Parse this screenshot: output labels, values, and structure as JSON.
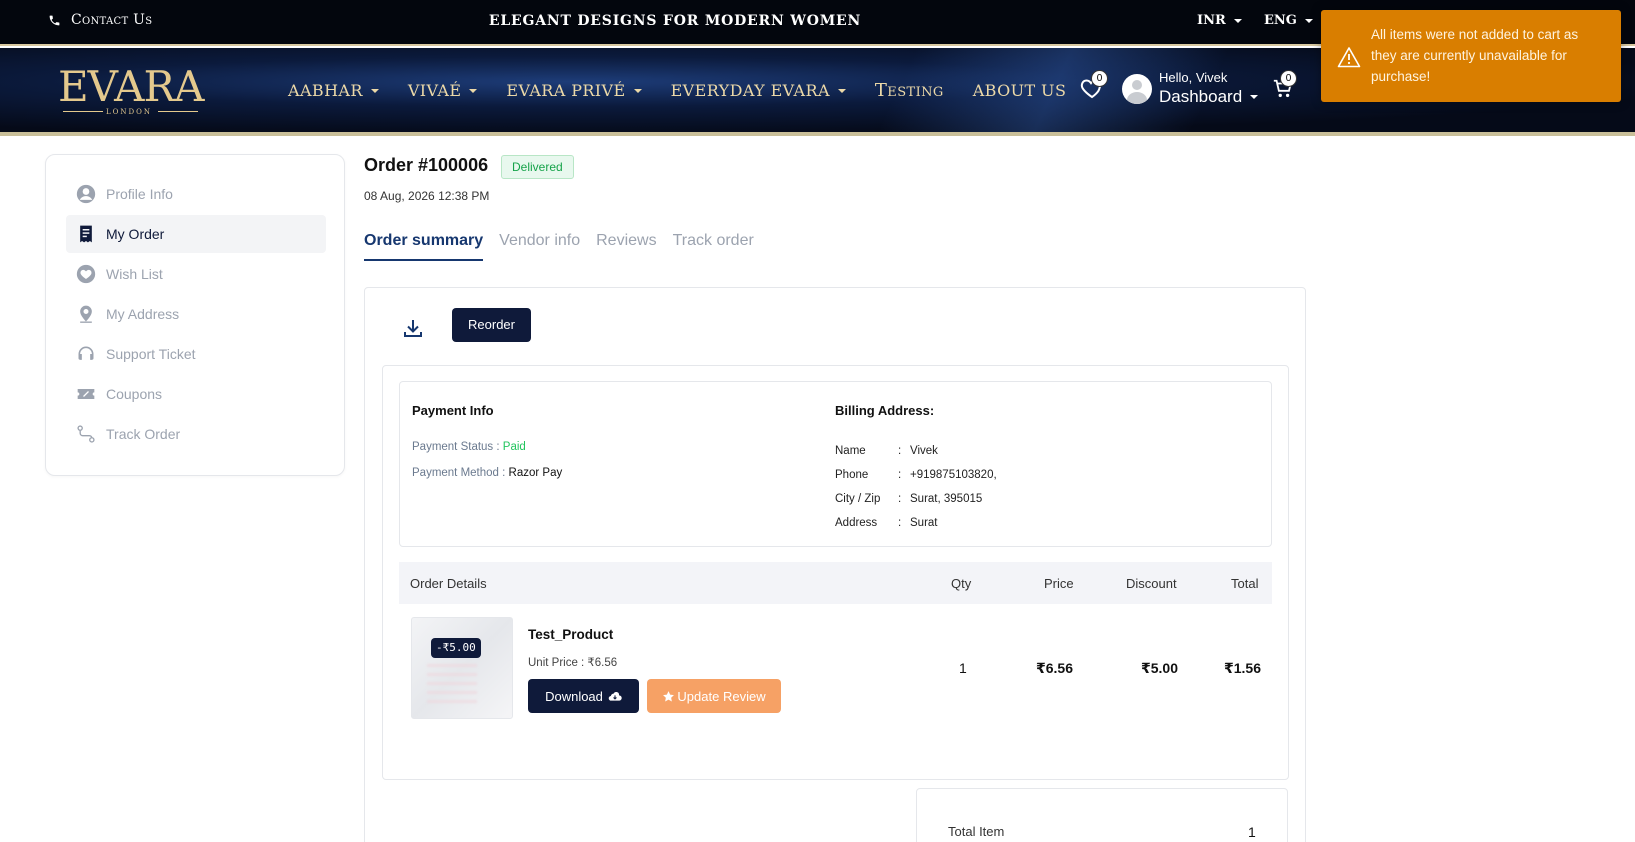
{
  "topbar": {
    "contact_label": "Contact Us",
    "tagline": "ELEGANT DESIGNS FOR MODERN WOMEN",
    "currency": "INR",
    "language": "ENG"
  },
  "brand": {
    "logo_text": "EVARA",
    "logo_sub": "LONDON",
    "accent_gold": "#e4c98d",
    "navy": "#0f1a3a"
  },
  "nav": {
    "items": [
      {
        "label": "AABHAR",
        "dropdown": true
      },
      {
        "label": "VIVAÉ",
        "dropdown": true
      },
      {
        "label": "EVARA PRIVÉ",
        "dropdown": true
      },
      {
        "label": "EVERYDAY EVARA",
        "dropdown": true
      },
      {
        "label": "Testing",
        "dropdown": false
      },
      {
        "label": "ABOUT US",
        "dropdown": false
      }
    ],
    "wishlist_count": "0",
    "cart_count": "0",
    "user_greeting": "Hello, Vivek",
    "dashboard_label": "Dashboard"
  },
  "toast": {
    "message": "All items were not added to cart as they are currently unavailable for purchase!",
    "color": "#d97e00"
  },
  "sidebar": {
    "items": [
      {
        "label": "Profile Info",
        "icon": "user-circle-icon"
      },
      {
        "label": "My Order",
        "icon": "receipt-icon",
        "active": true
      },
      {
        "label": "Wish List",
        "icon": "heart-icon"
      },
      {
        "label": "My Address",
        "icon": "map-pin-icon"
      },
      {
        "label": "Support Ticket",
        "icon": "headset-icon"
      },
      {
        "label": "Coupons",
        "icon": "coupon-icon"
      },
      {
        "label": "Track Order",
        "icon": "route-icon"
      }
    ]
  },
  "order": {
    "title": "Order #100006",
    "status": "Delivered",
    "date": "08 Aug, 2026 12:38 PM",
    "tabs": [
      "Order summary",
      "Vendor info",
      "Reviews",
      "Track order"
    ],
    "reorder_label": "Reorder"
  },
  "payment": {
    "heading": "Payment Info",
    "status_label": "Payment Status :",
    "status_value": "Paid",
    "method_label": "Payment Method :",
    "method_value": "Razor Pay"
  },
  "billing": {
    "heading": "Billing Address:",
    "rows": [
      {
        "key": "Name",
        "value": "Vivek"
      },
      {
        "key": "Phone",
        "value": "+919875103820,"
      },
      {
        "key": "City / Zip",
        "value": "Surat, 395015"
      },
      {
        "key": "Address",
        "value": "Surat"
      }
    ]
  },
  "details": {
    "headers": {
      "details": "Order Details",
      "qty": "Qty",
      "price": "Price",
      "discount": "Discount",
      "total": "Total"
    },
    "item": {
      "discount_tag": "-₹5.00",
      "name": "Test_Product",
      "unit_price": "Unit Price : ₹6.56",
      "download_label": "Download",
      "review_label": "Update Review",
      "qty": "1",
      "price": "₹6.56",
      "discount": "₹5.00",
      "total": "₹1.56"
    }
  },
  "summary": {
    "total_item_label": "Total Item",
    "total_item_value": "1"
  }
}
